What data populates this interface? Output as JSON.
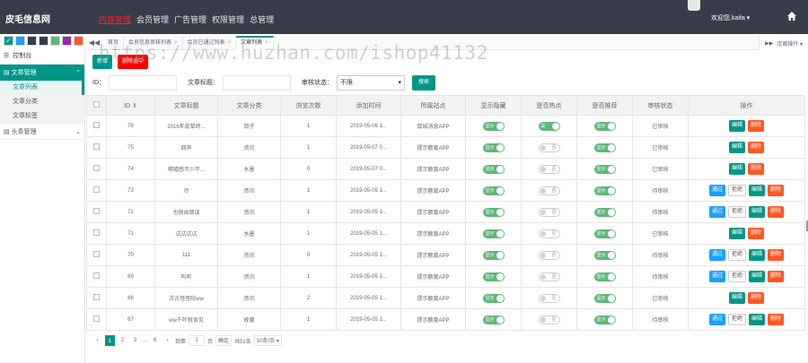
{
  "app": {
    "logo": "皮毛信息网",
    "user": "欢迎您,kaifa ▾"
  },
  "nav": [
    "内容管理",
    "会员管理",
    "广告管理",
    "权限管理",
    "总管理"
  ],
  "swatches": [
    "#009688",
    "#1e9fff",
    "#2f4056",
    "#393d49",
    "#5fb878",
    "#9c27b0",
    "#ff5722"
  ],
  "sidebar": {
    "top_label": "控制台",
    "groups": [
      {
        "label": "文章管理",
        "open": true,
        "items": [
          "文章列表",
          "文章分类",
          "文章标签"
        ]
      },
      {
        "label": "头条管理",
        "open": false,
        "items": []
      }
    ]
  },
  "tabs": [
    {
      "label": "首页",
      "active": false
    },
    {
      "label": "会员信息审核列表",
      "active": false
    },
    {
      "label": "会员已通过列表",
      "active": false
    },
    {
      "label": "文章列表",
      "active": true
    }
  ],
  "tab_ops_label": "页面操作 ▾",
  "toolbar": {
    "add": "新增",
    "batch_delete": "删除选中"
  },
  "filters": {
    "id_label": "ID：",
    "title_label": "文章标题：",
    "status_label": "审核状态：",
    "status_value": "不限",
    "search_label": "搜索"
  },
  "table": {
    "headers": [
      "",
      "ID ⇕",
      "文章标题",
      "文章分类",
      "浏览次数",
      "添加时间",
      "所属站点",
      "显示隐藏",
      "是否热点",
      "是否推荐",
      "审核状态",
      "操作"
    ],
    "rows": [
      {
        "id": "76",
        "title": "2016年皮草终...",
        "category": "鼠子",
        "views": "1",
        "time": "2019-05-06 1...",
        "site": "鼠城消息APP",
        "show": true,
        "hot": true,
        "rec": true,
        "status": "已审核",
        "ops": [
          "编辑",
          "删除"
        ]
      },
      {
        "id": "75",
        "title": "回声",
        "category": "资讯",
        "views": "1",
        "time": "2019-05-07 0...",
        "site": "提示额度APP",
        "show": true,
        "hot": false,
        "rec": true,
        "status": "已审核",
        "ops": [
          "编辑",
          "删除"
        ]
      },
      {
        "id": "74",
        "title": "唏嘘感不少不...",
        "category": "水墨",
        "views": "0",
        "time": "2019-05-07 0...",
        "site": "提示额度APP",
        "show": true,
        "hot": false,
        "rec": true,
        "status": "已审核",
        "ops": [
          "编辑",
          "删除"
        ]
      },
      {
        "id": "73",
        "title": "冷",
        "category": "资讯",
        "views": "1",
        "time": "2019-05-05 1...",
        "site": "提示额度APP",
        "show": true,
        "hot": false,
        "rec": true,
        "status": "待审核",
        "ops": [
          "通过",
          "拒绝",
          "编辑",
          "删除"
        ]
      },
      {
        "id": "72",
        "title": "也抛出错误",
        "category": "资讯",
        "views": "1",
        "time": "2019-05-05 1...",
        "site": "提示额度APP",
        "show": true,
        "hot": false,
        "rec": true,
        "status": "待审核",
        "ops": [
          "通过",
          "拒绝",
          "编辑",
          "删除"
        ]
      },
      {
        "id": "71",
        "title": "试试试试",
        "category": "水墨",
        "views": "1",
        "time": "2019-05-05 1...",
        "site": "提示额度APP",
        "show": true,
        "hot": false,
        "rec": true,
        "status": "已审核",
        "ops": [
          "编辑",
          "删除"
        ]
      },
      {
        "id": "70",
        "title": "111",
        "category": "资讯",
        "views": "0",
        "time": "2019-05-05 1...",
        "site": "提示额度APP",
        "show": true,
        "hot": false,
        "rec": true,
        "status": "待审核",
        "ops": [
          "通过",
          "拒绝",
          "编辑",
          "删除"
        ]
      },
      {
        "id": "69",
        "title": "叫听",
        "category": "资讯",
        "views": "1",
        "time": "2019-05-05 1...",
        "site": "提示额度APP",
        "show": true,
        "hot": false,
        "rec": true,
        "status": "待审核",
        "ops": [
          "通过",
          "拒绝",
          "编辑",
          "删除"
        ]
      },
      {
        "id": "68",
        "title": "古古怪怪咬ww",
        "category": "资讯",
        "views": "2",
        "time": "2019-05-05 1...",
        "site": "提示额度APP",
        "show": true,
        "hot": false,
        "rec": true,
        "status": "已审核",
        "ops": [
          "编辑",
          "删除"
        ]
      },
      {
        "id": "67",
        "title": "ww千叶就肯见",
        "category": "故婆",
        "views": "1",
        "time": "2019-05-05 1...",
        "site": "提示额度APP",
        "show": true,
        "hot": false,
        "rec": true,
        "status": "待审核",
        "ops": [
          "通过",
          "拒绝",
          "编辑",
          "删除"
        ]
      }
    ],
    "switch_on": "显示",
    "switch_off": "否",
    "hot_on": "是"
  },
  "pager": {
    "prev": "‹",
    "pages": [
      "1",
      "2",
      "3",
      "...",
      "6"
    ],
    "next": "›",
    "goto_label": "到第",
    "goto_value": "1",
    "page_unit": "页",
    "confirm": "确定",
    "total": "共51条",
    "per_page": "10条/页 ▾"
  },
  "watermark": "https://www.huzhan.com/ishop41132"
}
